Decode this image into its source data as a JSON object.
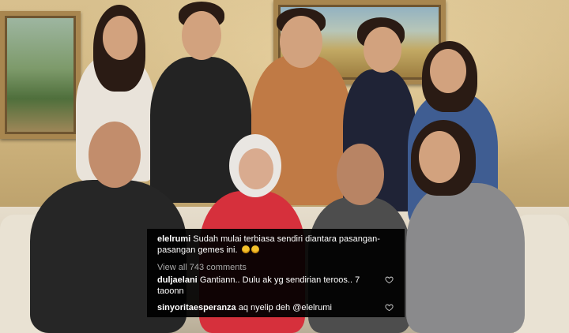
{
  "comments": {
    "caption": {
      "username": "elelrumi",
      "text": "Sudah mulai terbiasa sendiri diantara pasangan-pasangan gemes ini."
    },
    "view_all_label": "View all 743 comments",
    "items": [
      {
        "username": "duljaelani",
        "text_line1": "Gantiann.. Dulu ak yg sendirian teroos.. 7",
        "text_line2": "taoonn"
      },
      {
        "username": "sinyoritaesperanza",
        "text_line1": "aq nyelip deh @elelrumi"
      }
    ],
    "icons": {
      "emoji": "smiling-emoji-icon",
      "like": "heart-outline-icon"
    },
    "colors": {
      "overlay": "#000000",
      "text": "#ffffff",
      "muted": "#a9a9a9",
      "emoji": "#f4c12b"
    }
  }
}
